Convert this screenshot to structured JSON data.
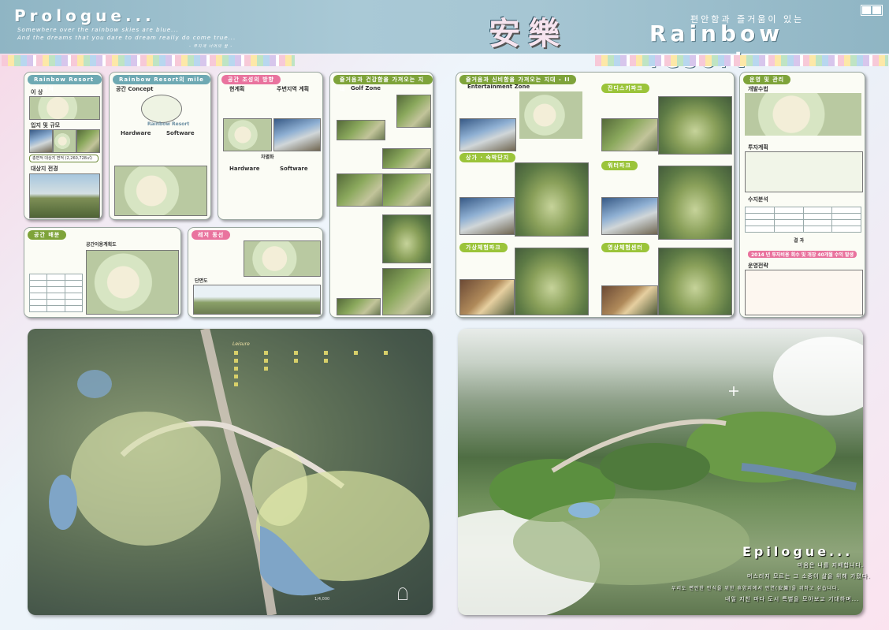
{
  "header": {
    "prologue_title": "Prologue...",
    "prologue_line1": "Somewhere over the rainbow skies are blue...",
    "prologue_line2": "And the dreams that you dare to dream really do come true...",
    "prologue_line3": "- 무지개 너머의 꿈 -",
    "main_title": "安樂",
    "tagline": "편안함과 즐거움이 있는",
    "resort_title": "Rainbow resort"
  },
  "panels": {
    "overview": {
      "title": "Rainbow Resort의 성격",
      "sec1": "이 상",
      "sec2": "입지 및 규모",
      "sec3": "대상지 전경",
      "area": "총면적 대상지 면적 (2,260,728㎡)"
    },
    "concept": {
      "title": "Rainbow Resort의 mile",
      "sec1": "공간 Concept",
      "hardware": "Hardware",
      "software": "Software",
      "logo": "Rainbow Resort"
    },
    "status": {
      "title": "공간 조성의 방향",
      "sec1": "현계획",
      "sec2": "주변지역 계획",
      "sec3": "차별화",
      "hardware": "Hardware",
      "software": "Software"
    },
    "golf": {
      "title": "즐거움과 건강함을 가져오는 지대",
      "sec1": "Golf Zone"
    },
    "space": {
      "title": "공간 배분",
      "sec1": "공간이용계획도"
    },
    "flow": {
      "title": "레저 동선",
      "sec1": "단면도"
    },
    "entertainment": {
      "title": "즐거움과 신비함을 가져오는 지대 - II",
      "sec1": "Entertainment Zone",
      "sec2": "잔디스키파크",
      "sec3": "상가 · 숙박단지",
      "sec4": "워터파크",
      "sec5": "가상체험파크",
      "sec6": "영상체험센터"
    },
    "operation": {
      "title": "운영 및 관리",
      "sec1": "개발수법",
      "sec2": "투자계획",
      "sec3": "수지분석",
      "sec4": "운영전략",
      "result": "결 과",
      "summary": "2014 년 투자비용 회수 및 개장 40개월 수익 발생"
    }
  },
  "site_plan": {
    "scale": "1/4,000"
  },
  "epilogue": {
    "title": "Epilogue...",
    "line1": "마음은 나를 지배합니다.",
    "line2": "머스러지 모르는 그 소중이 삶을 위해 가졌다.",
    "line3": "우리도 편안한 안식을 위한 휴양지에서 안연(安樂)을 위하고 싶습니다.",
    "line4": "내일 지친 마다 도시 특별을 모아보고 기대하며..."
  },
  "colors": {
    "header": "#a9c9d6",
    "title_green": "#9bc43a",
    "title_pink": "#e9739e",
    "title_teal": "#6ea9b3"
  }
}
